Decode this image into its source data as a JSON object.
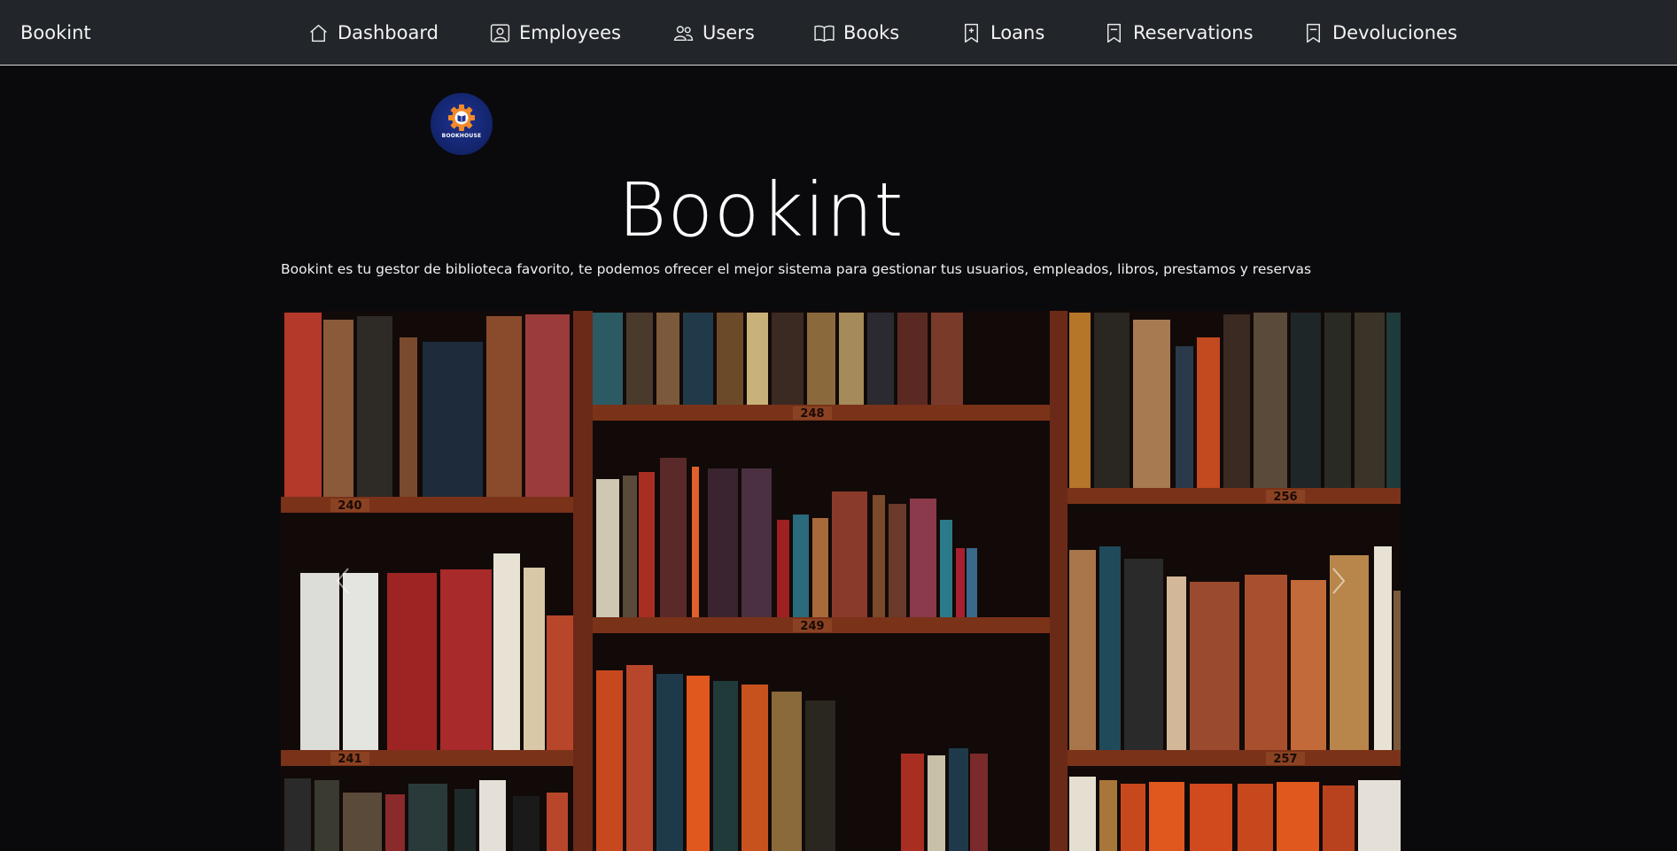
{
  "navbar": {
    "brand": "Bookint",
    "items": [
      {
        "label": "Dashboard",
        "icon": "home-icon"
      },
      {
        "label": "Employees",
        "icon": "person-badge-icon"
      },
      {
        "label": "Users",
        "icon": "people-icon"
      },
      {
        "label": "Books",
        "icon": "open-book-icon"
      },
      {
        "label": "Loans",
        "icon": "bookmark-icon"
      },
      {
        "label": "Reservations",
        "icon": "bookmark-icon"
      },
      {
        "label": "Devoluciones",
        "icon": "bookmark-icon"
      }
    ]
  },
  "hero": {
    "logo_text": "BOOKHOUSE",
    "title": "Bookint",
    "description": "Bookint es tu gestor de biblioteca favorito, te podemos ofrecer el mejor sistema para gestionar tus usuarios, empleados, libros, prestamos y reservas"
  },
  "carousel": {
    "shelf_numbers": [
      "240",
      "248",
      "256",
      "241",
      "249",
      "257"
    ],
    "prev_icon": "chevron-left-icon",
    "next_icon": "chevron-right-icon"
  },
  "colors": {
    "background": "#0a0a0d",
    "navbar": "#22262a",
    "logo_bg": "#142670",
    "shelf_wood": "#6b2a17"
  }
}
